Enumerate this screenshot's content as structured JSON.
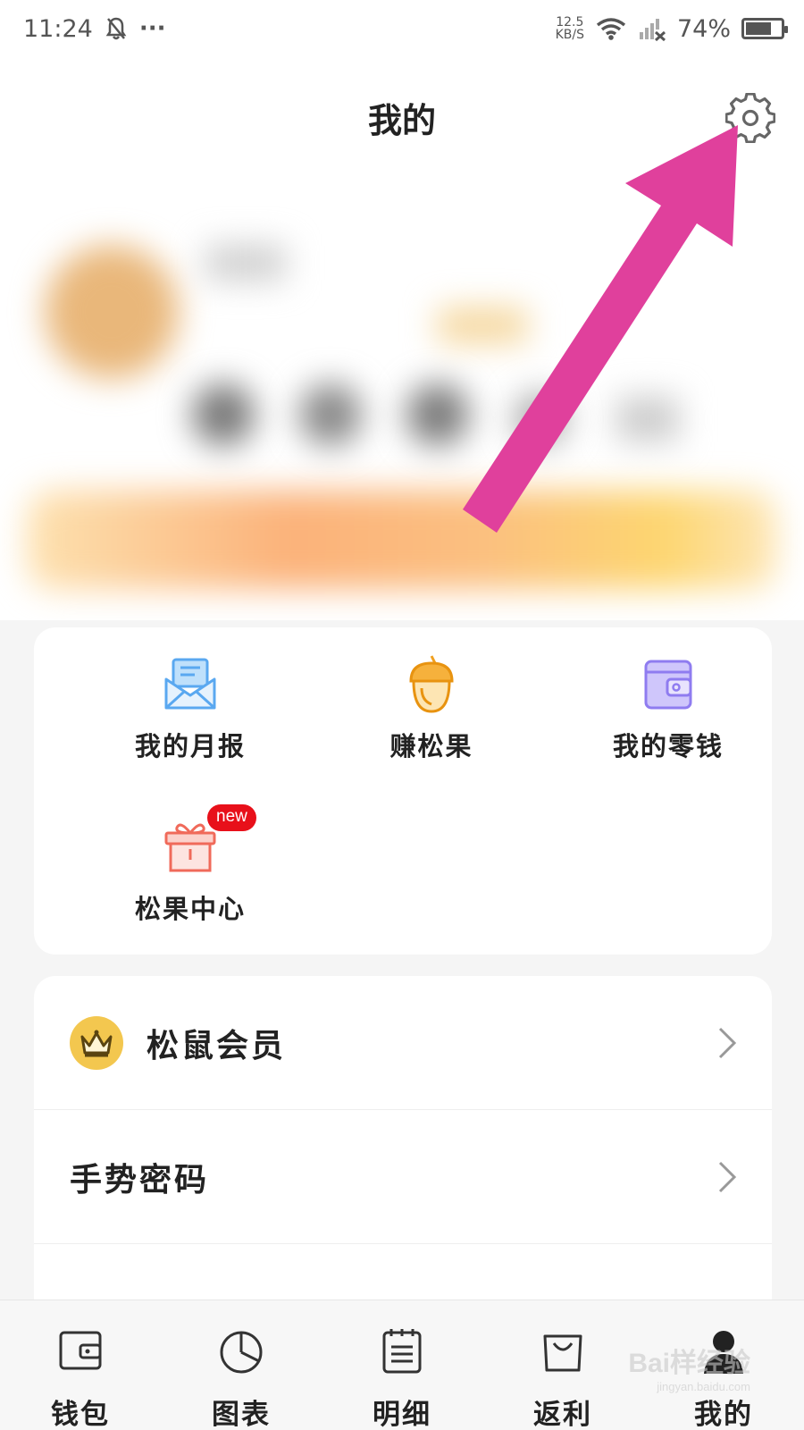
{
  "status_bar": {
    "time": "11:24",
    "more": "···",
    "net_speed_value": "12.5",
    "net_speed_unit": "KB/S",
    "battery_percent": "74%",
    "battery_level": 0.74
  },
  "header": {
    "title": "我的",
    "settings_icon": "gear-icon"
  },
  "annotation": {
    "arrow_color": "#e0409c"
  },
  "quick_actions": [
    {
      "label": "我的月报",
      "icon": "mail-report-icon"
    },
    {
      "label": "赚松果",
      "icon": "acorn-icon"
    },
    {
      "label": "我的零钱",
      "icon": "wallet-icon"
    },
    {
      "label": "松果中心",
      "icon": "gift-icon",
      "badge": "new"
    }
  ],
  "menu_list": [
    {
      "label": "松鼠会员",
      "icon": "crown-icon"
    },
    {
      "label": "手势密码"
    }
  ],
  "bottom_nav": [
    {
      "label": "钱包",
      "icon": "wallet-icon"
    },
    {
      "label": "图表",
      "icon": "pie-chart-icon"
    },
    {
      "label": "明细",
      "icon": "list-icon"
    },
    {
      "label": "返利",
      "icon": "shopping-bag-icon"
    },
    {
      "label": "我的",
      "icon": "user-icon",
      "active": true
    }
  ],
  "watermark": {
    "brand": "Bai样经验",
    "url": "jingyan.baidu.com"
  },
  "colors": {
    "accent_pink": "#e0409c",
    "badge_red": "#e8101a",
    "crown_yellow": "#f3c74f",
    "acorn_orange": "#f0a020",
    "mail_blue": "#5aa8f0",
    "wallet_purple": "#8f7cf0",
    "gift_red": "#f06a5a"
  }
}
